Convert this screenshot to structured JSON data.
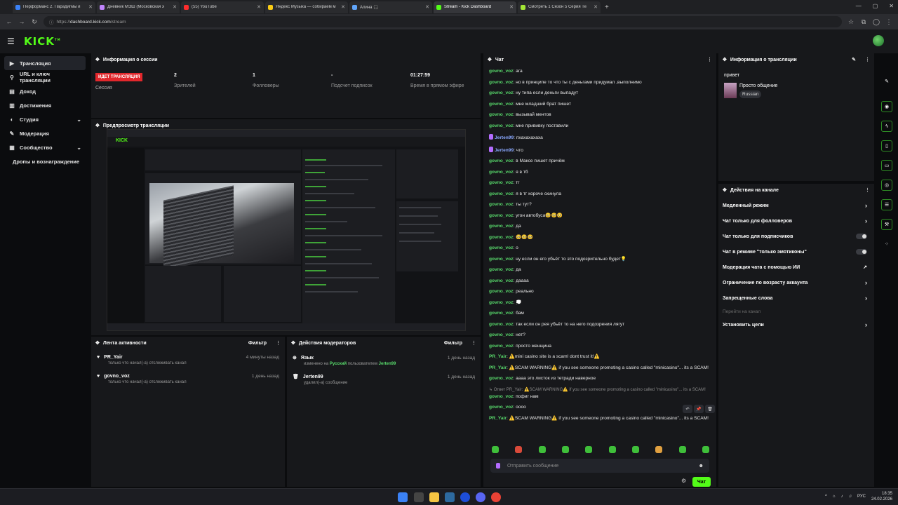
{
  "browser": {
    "tabs": [
      {
        "title": "Перформанс 2. Парадигмы и",
        "color": "#3b82f6",
        "active": false
      },
      {
        "title": "Дневник МЭШ (Московская э",
        "color": "#c084fc",
        "active": false
      },
      {
        "title": "(55) YouTube",
        "color": "#ff2d2d",
        "active": false
      },
      {
        "title": "Яндекс Музыка — собираем м",
        "color": "#facc15",
        "active": false
      },
      {
        "title": "Алина 🎧",
        "color": "#60a5fa",
        "active": false
      },
      {
        "title": "Stream - Kick Dashboard",
        "color": "#53fc18",
        "active": true
      },
      {
        "title": "Смотреть 1 Сезон 5 Серия Те",
        "color": "#a3e635",
        "active": false
      }
    ],
    "url_prefix": "https://",
    "url_domain": "dashboard.kick.com",
    "url_path": "/stream"
  },
  "header": {
    "logo": "KICK",
    "logo_tm": "TM"
  },
  "sidebar": {
    "items": [
      {
        "label": "Трансляция",
        "icon": "broadcast-icon",
        "glyph": "▶",
        "active": true
      },
      {
        "label": "URL и ключ трансляции",
        "icon": "key-icon",
        "glyph": "⚲"
      },
      {
        "label": "Доход",
        "icon": "wallet-icon",
        "glyph": "▤"
      },
      {
        "label": "Достижения",
        "icon": "trophy-icon",
        "glyph": "▥"
      },
      {
        "label": "Студия",
        "icon": "palette-icon",
        "glyph": "◐",
        "chevron": true
      },
      {
        "label": "Модерация",
        "icon": "hammer-icon",
        "glyph": "✎"
      },
      {
        "label": "Сообщество",
        "icon": "community-icon",
        "glyph": "▦",
        "chevron": true
      },
      {
        "label": "Дропы и вознаграждение",
        "icon": "",
        "glyph": "",
        "sub": true
      }
    ]
  },
  "session": {
    "title": "Информация о сессии",
    "live_badge": "ИДЕТ ТРАНСЛЯЦИЯ",
    "live_label": "Сессия",
    "viewers_value": "2",
    "viewers_label": "Зрителей",
    "followers_value": "1",
    "followers_label": "Фолловеры",
    "subs_value": "-",
    "subs_label": "Подсчет подписок",
    "uptime_value": "01:27:59",
    "uptime_label": "Время в прямом эфире"
  },
  "preview": {
    "title": "Предпросмотр трансляции"
  },
  "activity": {
    "title": "Лента активности",
    "filter": "Фильтр",
    "items": [
      {
        "user": "PR_Yair",
        "text": "только что начал(-а) отслеживать канал",
        "time": "4 минуты назад"
      },
      {
        "user": "govno_voz",
        "text": "только что начал(-а) отслеживать канал",
        "time": "1 день назад"
      }
    ]
  },
  "modactions": {
    "title": "Действия модераторов",
    "filter": "Фильтр",
    "items": [
      {
        "title": "Язык",
        "pre": "изменено на ",
        "hl1": "Русский",
        "mid": " пользователем ",
        "hl2": "Jerten99",
        "time": "1 день назад"
      },
      {
        "title": "Jerten99",
        "pre": "удалил(-а) сообщение",
        "time": "1 день назад"
      }
    ]
  },
  "chat": {
    "title": "Чат",
    "messages": [
      {
        "u": "govno_voz",
        "t": "ага"
      },
      {
        "u": "govno_voz",
        "t": "но в принципе то что ты с деньгами придумал ,выполнимо"
      },
      {
        "u": "govno_voz",
        "t": "ну типа если деньги выпадут"
      },
      {
        "u": "govno_voz",
        "t": "мне младший брат пишет"
      },
      {
        "u": "govno_voz",
        "t": "вызывай ментов"
      },
      {
        "u": "govno_voz",
        "t": "мне прививку поставили"
      },
      {
        "u": "Jerten99",
        "t": "пхахахахаха",
        "badge": true
      },
      {
        "u": "Jerten99",
        "t": "что",
        "badge": true
      },
      {
        "u": "govno_voz",
        "t": "в Максе пишет причём"
      },
      {
        "u": "govno_voz",
        "t": "я в тб"
      },
      {
        "u": "govno_voz",
        "t": "тг"
      },
      {
        "u": "govno_voz",
        "t": "я в тг короче скинула"
      },
      {
        "u": "govno_voz",
        "t": "ты тут?"
      },
      {
        "u": "govno_voz",
        "t": "угон автобуса🥺🥺🥺"
      },
      {
        "u": "govno_voz",
        "t": "да"
      },
      {
        "u": "govno_voz",
        "t": "🥺🥺🥺"
      },
      {
        "u": "govno_voz",
        "t": "о"
      },
      {
        "u": "govno_voz",
        "t": "ну если он его убьёт то это подозрительно будет💡"
      },
      {
        "u": "govno_voz",
        "t": "да"
      },
      {
        "u": "govno_voz",
        "t": "даааа"
      },
      {
        "u": "govno_voz",
        "t": "реально"
      },
      {
        "u": "govno_voz",
        "t": "💭"
      },
      {
        "u": "govno_voz",
        "t": "бам"
      },
      {
        "u": "govno_voz",
        "t": "так если он рея убьёт то на него подозрения лягут"
      },
      {
        "u": "govno_voz",
        "t": "нет?"
      },
      {
        "u": "govno_voz",
        "t": "просто женщина"
      },
      {
        "u": "PR_Yair",
        "t": "⚠️mini casino site is a scam! dont trust it!⚠️"
      },
      {
        "u": "PR_Yair",
        "t": "⚠️SCAM WARNING⚠️ if you see someone promoting a casino called \"minicasino\"... its a SCAM!"
      },
      {
        "u": "govno_voz",
        "t": "аааа это листок из тетради наверное"
      },
      {
        "u": "",
        "t": "↳ Ответ PR_Yair: ⚠️SCAM WARNING⚠️ if you see someone promoting a casino called \"minicasino\"... its a SCAM!",
        "reply": true
      },
      {
        "u": "govno_voz",
        "t": "пофиг нам"
      },
      {
        "u": "govno_voz",
        "t": "оооо"
      },
      {
        "u": "PR_Yair",
        "t": "⚠️SCAM WARNING⚠️ if you see someone promoting a casino called \"minicasino\"... its a SCAM!"
      }
    ],
    "input_placeholder": "Отправить сообщение",
    "send_label": "Чат"
  },
  "stream_info": {
    "title": "Информация о трансляции",
    "stream_title": "привет",
    "category": "Просто общение",
    "language": "Russian"
  },
  "channel_actions": {
    "title": "Действия на канале",
    "items": [
      {
        "label": "Медленный режим",
        "kind": "arrow"
      },
      {
        "label": "Чат только для фолловеров",
        "kind": "arrow"
      },
      {
        "label": "Чат только для подписчиков",
        "kind": "toggle"
      },
      {
        "label": "Чат в режиме \"только эмотиконы\"",
        "kind": "toggle"
      },
      {
        "label": "Модерация чата с помощью ИИ",
        "kind": "ext"
      },
      {
        "label": "Ограничение по возрасту аккаунта",
        "kind": "arrow"
      },
      {
        "label": "Запрещенные слова",
        "kind": "arrow"
      },
      {
        "label": "Перейти на канал",
        "kind": "dim"
      },
      {
        "label": "Установить цели",
        "kind": "arrow"
      }
    ]
  },
  "taskbar": {
    "lang": "РУС",
    "time": "18:35",
    "date": "24.02.2026"
  }
}
